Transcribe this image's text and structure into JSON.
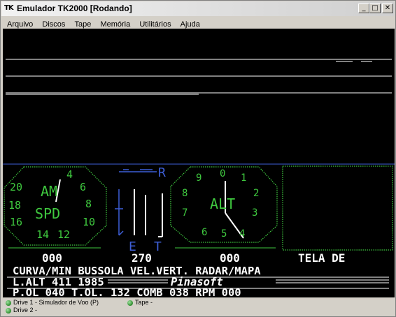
{
  "window": {
    "icon": "TK",
    "title": "Emulador TK2000 [Rodando]",
    "buttons": {
      "minimize": "minimize-icon",
      "maximize": "maximize-icon",
      "close": "close-icon"
    }
  },
  "menu": [
    "Arquivo",
    "Discos",
    "Tape",
    "Memória",
    "Utilitários",
    "Ajuda"
  ],
  "screen": {
    "gauges": {
      "airspeed_label_top": "AM",
      "airspeed_label_bottom": "SPD",
      "airspeed_digits": [
        "4",
        "20",
        "6",
        "18",
        "8",
        "16",
        "10",
        "14",
        "12"
      ],
      "compass_labels": [
        "E",
        "T"
      ],
      "compass_top": "R",
      "altimeter_label": "ALT",
      "altimeter_digits": [
        "0",
        "9",
        "1",
        "8",
        "2",
        "7",
        "3",
        "6",
        "5",
        "4"
      ]
    },
    "readouts": {
      "curva_value": "000",
      "bussola_value": "270",
      "velvert_value": "000",
      "tela_label": "TELA DE"
    },
    "lines": [
      "CURVA/MIN  BUSSOLA VEL.VERT. RADAR/MAPA",
      "L.ALT 411             1985",
      "P.OL  040 T.OL.  132  COMB 038 RPM  000"
    ],
    "brand": "Pinasoft",
    "colors": {
      "background": "#000000",
      "phosphor": "#3fc93f",
      "white": "#ffffff",
      "blue": "#3e5fd8"
    }
  },
  "status": {
    "drive1": "Drive 1 - Simulador de Voo (P)",
    "drive2": "Drive 2 -",
    "tape": "Tape -",
    "led_color": "#2e8b2e"
  }
}
